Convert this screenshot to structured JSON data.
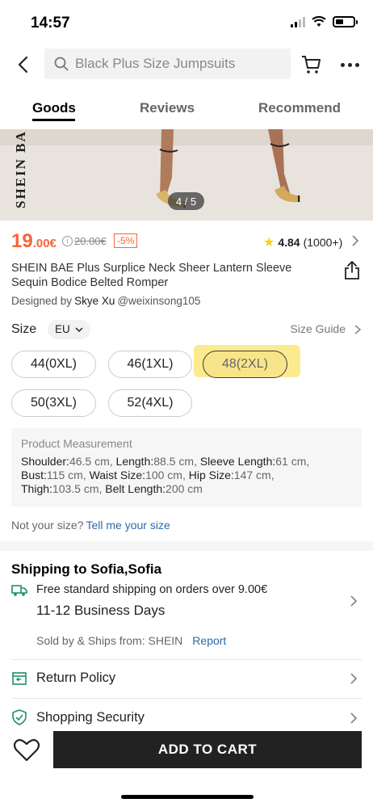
{
  "status_bar": {
    "time": "14:57"
  },
  "search": {
    "placeholder": "Black Plus Size Jumpsuits"
  },
  "tabs": [
    {
      "label": "Goods",
      "active": true
    },
    {
      "label": "Reviews",
      "active": false
    },
    {
      "label": "Recommend",
      "active": false
    }
  ],
  "gallery": {
    "brand_watermark": "SHEIN BAE",
    "counter": "4 / 5"
  },
  "price": {
    "current_int": "19",
    "current_frac": ".00€",
    "original": "20.00€",
    "discount": "-5%",
    "accent_color": "#fa6338"
  },
  "rating": {
    "score": "4.84",
    "count": "(1000+)"
  },
  "product": {
    "title": "SHEIN BAE Plus Surplice Neck Sheer Lantern Sleeve Sequin Bodice Belted Romper",
    "designed_by_label": "Designed by",
    "designer_name": "Skye Xu",
    "designer_handle": "@weixinsong105"
  },
  "size": {
    "label": "Size",
    "region": "EU",
    "guide_label": "Size Guide",
    "options": [
      {
        "label": "44(0XL)",
        "selected": false
      },
      {
        "label": "46(1XL)",
        "selected": false
      },
      {
        "label": "48(2XL)",
        "selected": true
      },
      {
        "label": "50(3XL)",
        "selected": false
      },
      {
        "label": "52(4XL)",
        "selected": false
      }
    ]
  },
  "measurement": {
    "title": "Product Measurement",
    "items": [
      {
        "key": "Shoulder:",
        "value": "46.5 cm"
      },
      {
        "key": "Length:",
        "value": "88.5 cm"
      },
      {
        "key": "Sleeve Length:",
        "value": "61 cm"
      },
      {
        "key": "Bust:",
        "value": "115 cm"
      },
      {
        "key": "Waist Size:",
        "value": "100 cm"
      },
      {
        "key": "Hip Size:",
        "value": "147 cm"
      },
      {
        "key": "Thigh:",
        "value": "103.5 cm"
      },
      {
        "key": "Belt Length:",
        "value": "200 cm"
      }
    ]
  },
  "fit": {
    "question": "Not your size?",
    "link": "Tell me your size"
  },
  "shipping": {
    "title": "Shipping to Sofia,Sofia",
    "free_text": "Free standard shipping on orders over 9.00€",
    "days": "11-12 Business Days",
    "sold_by": "Sold by & Ships from: SHEIN",
    "report": "Report"
  },
  "policies": [
    {
      "label": "Return Policy",
      "icon": "return-box-icon"
    },
    {
      "label": "Shopping Security",
      "icon": "shield-check-icon"
    }
  ],
  "bottom": {
    "add_to_cart": "ADD TO CART"
  }
}
